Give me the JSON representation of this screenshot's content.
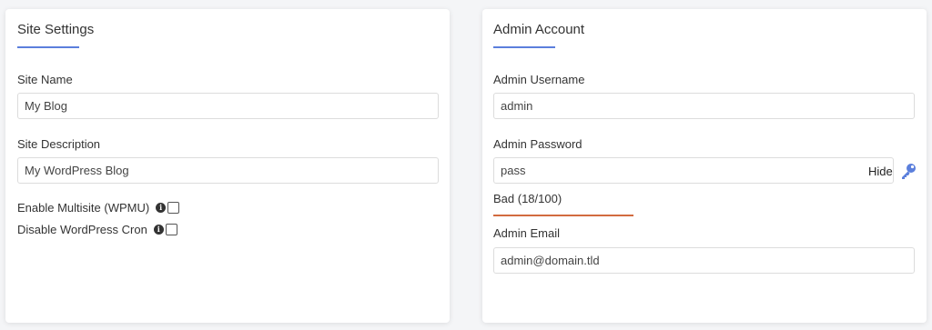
{
  "site_settings": {
    "title": "Site Settings",
    "site_name": {
      "label": "Site Name",
      "value": "My Blog"
    },
    "site_description": {
      "label": "Site Description",
      "value": "My WordPress Blog"
    },
    "enable_multisite": {
      "label": "Enable Multisite (WPMU)",
      "checked": false
    },
    "disable_cron": {
      "label": "Disable WordPress Cron",
      "checked": false
    }
  },
  "admin_account": {
    "title": "Admin Account",
    "username": {
      "label": "Admin Username",
      "value": "admin"
    },
    "password": {
      "label": "Admin Password",
      "value": "pass",
      "hide_label": "Hide",
      "strength_text": "Bad (18/100)",
      "strength_color": "#d26b3f"
    },
    "email": {
      "label": "Admin Email",
      "value": "admin@domain.tld"
    }
  },
  "colors": {
    "accent": "#5b7fdc",
    "key_icon": "#5b7fdc"
  }
}
